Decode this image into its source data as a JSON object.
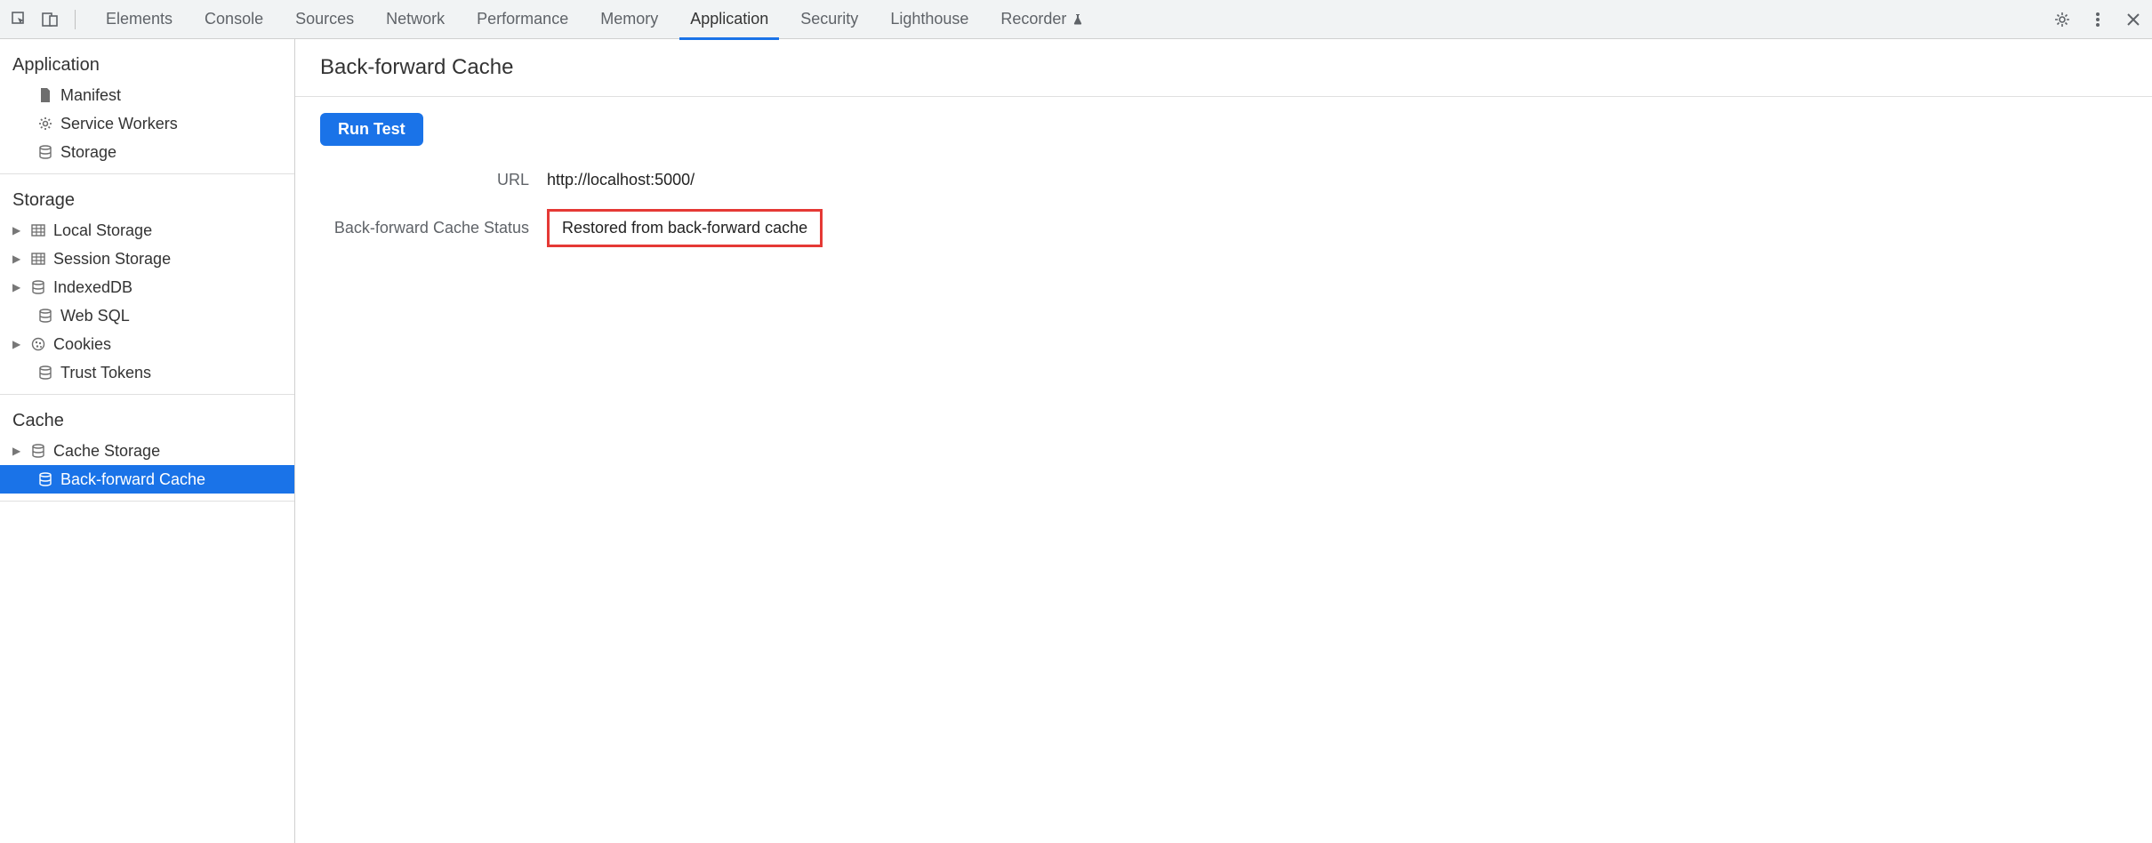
{
  "toolbar": {
    "tabs": [
      {
        "label": "Elements",
        "active": false
      },
      {
        "label": "Console",
        "active": false
      },
      {
        "label": "Sources",
        "active": false
      },
      {
        "label": "Network",
        "active": false
      },
      {
        "label": "Performance",
        "active": false
      },
      {
        "label": "Memory",
        "active": false
      },
      {
        "label": "Application",
        "active": true
      },
      {
        "label": "Security",
        "active": false
      },
      {
        "label": "Lighthouse",
        "active": false
      },
      {
        "label": "Recorder",
        "active": false,
        "experimental": true
      }
    ]
  },
  "sidebar": {
    "sections": {
      "application": {
        "title": "Application",
        "items": [
          {
            "label": "Manifest",
            "icon": "file"
          },
          {
            "label": "Service Workers",
            "icon": "gear"
          },
          {
            "label": "Storage",
            "icon": "db"
          }
        ]
      },
      "storage": {
        "title": "Storage",
        "items": [
          {
            "label": "Local Storage",
            "icon": "table",
            "expandable": true
          },
          {
            "label": "Session Storage",
            "icon": "table",
            "expandable": true
          },
          {
            "label": "IndexedDB",
            "icon": "db",
            "expandable": true
          },
          {
            "label": "Web SQL",
            "icon": "db"
          },
          {
            "label": "Cookies",
            "icon": "cookie",
            "expandable": true
          },
          {
            "label": "Trust Tokens",
            "icon": "db"
          }
        ]
      },
      "cache": {
        "title": "Cache",
        "items": [
          {
            "label": "Cache Storage",
            "icon": "db",
            "expandable": true
          },
          {
            "label": "Back-forward Cache",
            "icon": "db",
            "selected": true
          }
        ]
      }
    }
  },
  "content": {
    "title": "Back-forward Cache",
    "run_button": "Run Test",
    "rows": {
      "url_label": "URL",
      "url_value": "http://localhost:5000/",
      "status_label": "Back-forward Cache Status",
      "status_value": "Restored from back-forward cache"
    }
  }
}
